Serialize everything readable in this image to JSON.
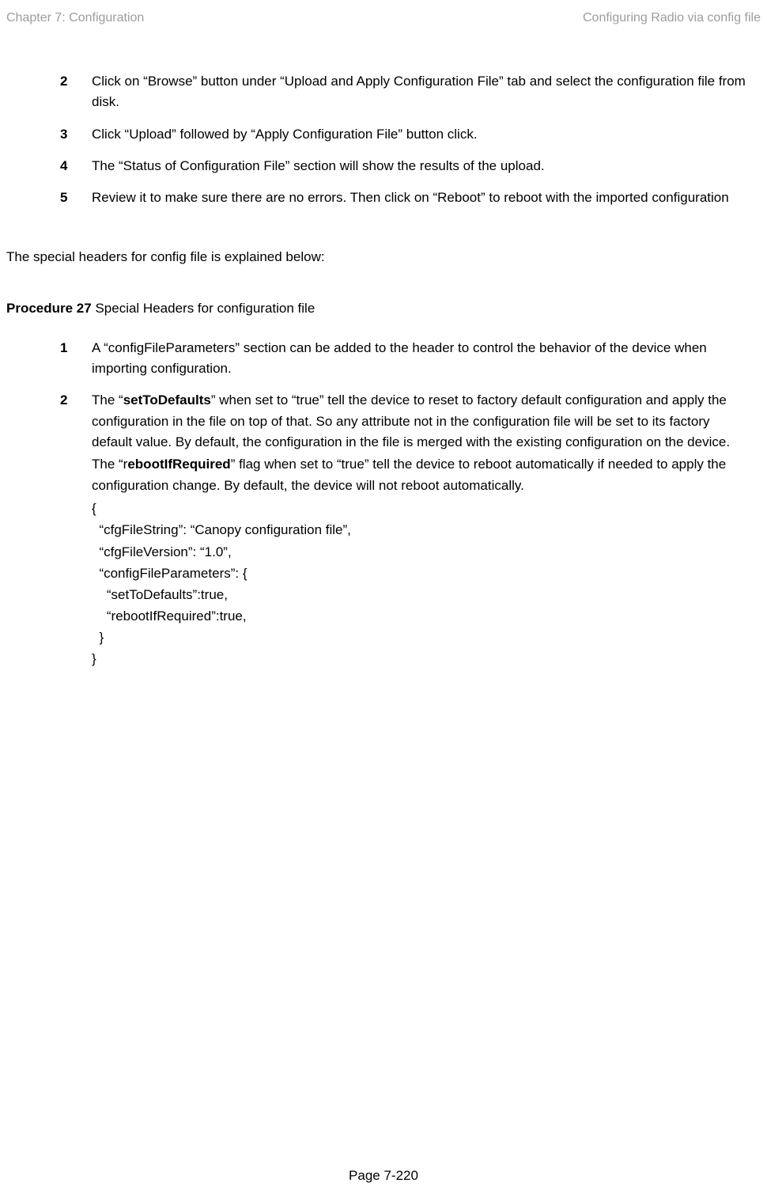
{
  "header": {
    "left": "Chapter 7:  Configuration",
    "right": "Configuring Radio via config file"
  },
  "list1": [
    {
      "num": "2",
      "text": "Click on “Browse” button under “Upload and Apply Configuration File” tab and select the configuration file from disk."
    },
    {
      "num": "3",
      "text": "Click “Upload” followed by “Apply Configuration File” button click."
    },
    {
      "num": "4",
      "text": "The “Status of Configuration File” section will show the results of the upload."
    },
    {
      "num": "5",
      "text": "Review it to make sure there are no errors. Then click on “Reboot” to reboot with the imported configuration"
    }
  ],
  "intro": "The special headers for config file is explained below:",
  "procedure": {
    "label": "Procedure 27",
    "title": " Special Headers for configuration file"
  },
  "list2": {
    "item1": {
      "num": "1",
      "text": "A “configFileParameters” section can be added to the header to control the behavior of the device when importing configuration."
    },
    "item2": {
      "num": "2",
      "prefix": "The “",
      "bold1": "setToDefaults",
      "after1": "” when set to “true” tell the device to reset to factory default configuration and apply the configuration in the file on top of that. So any attribute not in the configuration file will be set to its factory default value. By default, the configuration in the file is merged with the existing configuration on the device."
    },
    "item2b": {
      "prefix": "The “r",
      "bold": "ebootIfRequired",
      "after": "” flag when set to “true” tell the device to reboot automatically if needed to apply the configuration change. By default, the device will not reboot automatically."
    }
  },
  "code": {
    "l1": "{",
    "l2": "  “cfgFileString”: “Canopy configuration file”,",
    "l3": "  “cfgFileVersion”: “1.0”,",
    "l4": "  “configFileParameters”: {",
    "l5": "    “setToDefaults”:true,",
    "l6": "    “rebootIfRequired”:true,",
    "l7": "  }",
    "l8": "}"
  },
  "footer": "Page 7-220"
}
